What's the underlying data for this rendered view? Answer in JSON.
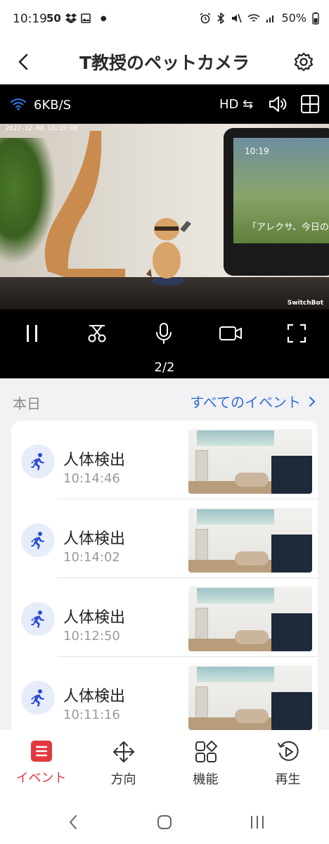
{
  "status_bar": {
    "time": "10:19",
    "notif_count": "50",
    "battery": "50%"
  },
  "header": {
    "title": "T教授のペットカメラ"
  },
  "camera": {
    "speed": "6KB/S",
    "quality": "HD",
    "timestamp": "2022-12-08 10:19:08",
    "brand": "SwitchBot",
    "echo_time": "10:19",
    "echo_text": "「アレクサ、今日の",
    "page_indicator": "2/2"
  },
  "events": {
    "today_label": "本日",
    "all_events_label": "すべてのイベント",
    "items": [
      {
        "title": "人体検出",
        "time": "10:14:46"
      },
      {
        "title": "人体検出",
        "time": "10:14:02"
      },
      {
        "title": "人体検出",
        "time": "10:12:50"
      },
      {
        "title": "人体検出",
        "time": "10:11:16"
      }
    ]
  },
  "bottom_nav": {
    "items": [
      {
        "label": "イベント",
        "icon": "list-icon",
        "active": true
      },
      {
        "label": "方向",
        "icon": "move-arrows-icon",
        "active": false
      },
      {
        "label": "機能",
        "icon": "grid-shapes-icon",
        "active": false
      },
      {
        "label": "再生",
        "icon": "replay-icon",
        "active": false
      }
    ]
  },
  "colors": {
    "accent_red": "#e2383f",
    "link_blue": "#2f6fd6",
    "event_icon_blue": "#2d4fd6"
  }
}
